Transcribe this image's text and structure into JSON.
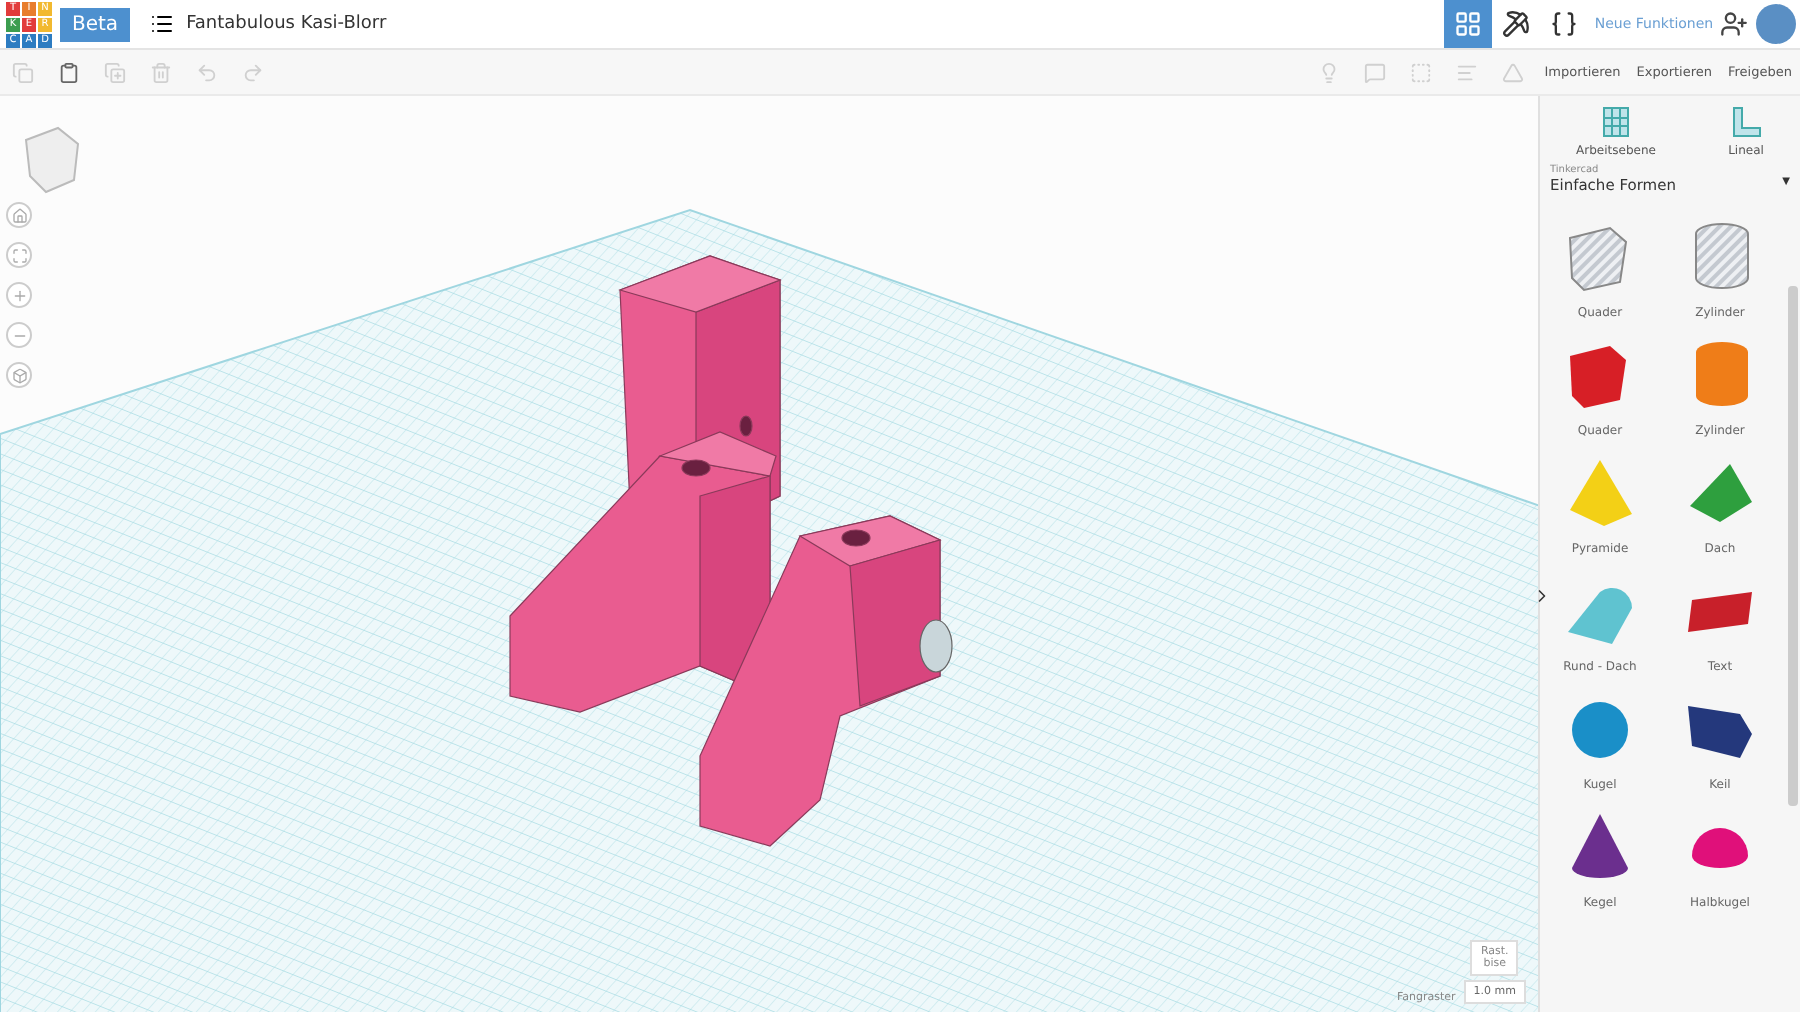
{
  "logo": {
    "letters": [
      "T",
      "I",
      "N",
      "K",
      "E",
      "R",
      "C",
      "A",
      "D"
    ]
  },
  "topbar": {
    "badge": "Beta",
    "title": "Fantabulous Kasi-Blorr",
    "new_features": "Neue Funktionen"
  },
  "actions": [
    "Importieren",
    "Exportieren",
    "Freigeben"
  ],
  "tools": [
    {
      "kind": "workplane",
      "label": "Arbeitsebene"
    },
    {
      "kind": "ruler",
      "label": "Lineal"
    }
  ],
  "library": {
    "source": "Tinkercad",
    "category": "Einfache Formen",
    "caret": "▼"
  },
  "shapes": [
    {
      "kind": "box",
      "label": "Quader",
      "color": "#c4c9d0",
      "hole": true
    },
    {
      "kind": "cylinder",
      "label": "Zylinder",
      "color": "#c4c9d0",
      "hole": true
    },
    {
      "kind": "box",
      "label": "Quader",
      "color": "#d71f26",
      "hole": false
    },
    {
      "kind": "cylinder",
      "label": "Zylinder",
      "color": "#ef7d18",
      "hole": false
    },
    {
      "kind": "pyramid",
      "label": "Pyramide",
      "color": "#f3d016",
      "hole": false
    },
    {
      "kind": "roof",
      "label": "Dach",
      "color": "#2e9f3e",
      "hole": false
    },
    {
      "kind": "roundroof",
      "label": "Rund - Dach",
      "color": "#5fc3d0",
      "hole": false
    },
    {
      "kind": "text",
      "label": "Text",
      "color": "#c8202a",
      "hole": false
    },
    {
      "kind": "sphere",
      "label": "Kugel",
      "color": "#1a8fc8",
      "hole": false
    },
    {
      "kind": "wedge",
      "label": "Keil",
      "color": "#24387c",
      "hole": false
    },
    {
      "kind": "cone",
      "label": "Kegel",
      "color": "#6b2f8e",
      "hole": false
    },
    {
      "kind": "halfsphere",
      "label": "Halbkugel",
      "color": "#e0107a",
      "hole": false
    }
  ],
  "snap": {
    "edit_grid": "Rast. bise",
    "label": "Fangraster",
    "value": "1.0 mm"
  }
}
